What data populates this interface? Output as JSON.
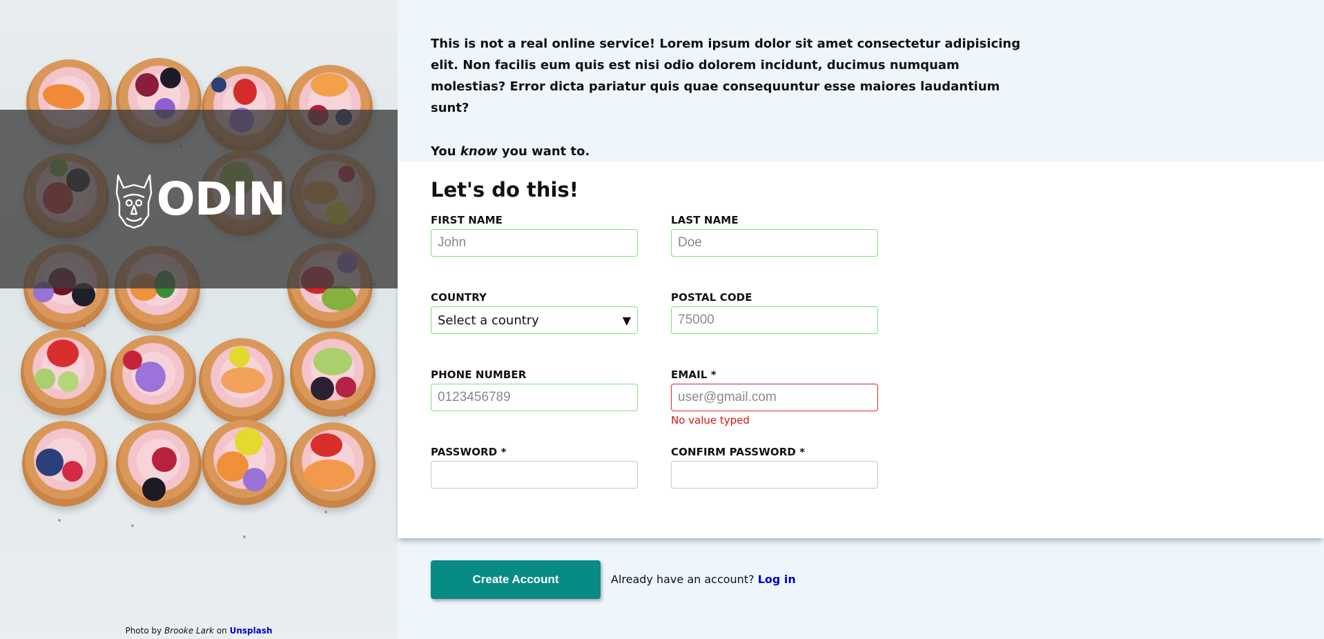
{
  "hero": {
    "brand_name": "ODIN",
    "credit": {
      "prefix": "Photo by",
      "author": "Brooke Lark",
      "connector": "on",
      "source": "Unsplash"
    }
  },
  "intro": {
    "paragraph": "This is not a real online service! Lorem ipsum dolor sit amet consectetur adipisicing elit. Non facilis eum quis est nisi odio dolorem incidunt, ducimus numquam molestias? Error dicta pariatur quis quae consequuntur esse maiores laudantium sunt?",
    "tag_before": "You",
    "tag_emphasis": "know",
    "tag_after": "you want to."
  },
  "form": {
    "title": "Let's do this!",
    "fields": {
      "first_name": {
        "label": "First Name",
        "placeholder": "John",
        "value": ""
      },
      "last_name": {
        "label": "Last Name",
        "placeholder": "Doe",
        "value": ""
      },
      "country": {
        "label": "Country",
        "selected": "Select a country"
      },
      "postal_code": {
        "label": "Postal Code",
        "placeholder": "75000",
        "value": ""
      },
      "phone": {
        "label": "Phone Number",
        "placeholder": "0123456789",
        "value": ""
      },
      "email": {
        "label": "Email *",
        "placeholder": "user@gmail.com",
        "value": "",
        "error": "No value typed"
      },
      "password": {
        "label": "Password *",
        "placeholder": "",
        "value": ""
      },
      "confirm_password": {
        "label": "Confirm Password *",
        "placeholder": "",
        "value": ""
      }
    }
  },
  "actions": {
    "create_label": "Create Account",
    "login_prompt": "Already have an account?",
    "login_link": "Log in"
  },
  "colors": {
    "accent": "#088a85",
    "valid_border": "#7ee07e",
    "error": "#e0242b",
    "link": "#0000cc",
    "panel_bg": "#eef6fc"
  }
}
